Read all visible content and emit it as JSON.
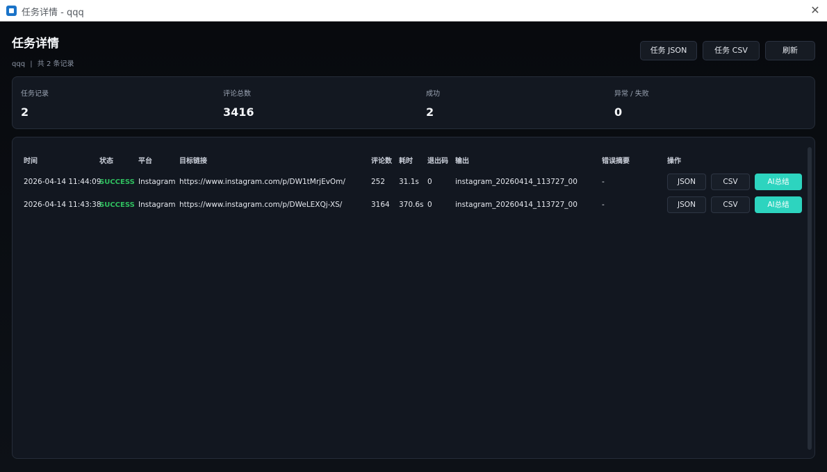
{
  "window": {
    "title": "任务详情 - qqq",
    "close_glyph": "✕"
  },
  "header": {
    "title": "任务详情",
    "task_name": "qqq",
    "separator": "|",
    "record_count": "共 2 条记录",
    "buttons": {
      "task_json": "任务 JSON",
      "task_csv": "任务 CSV",
      "refresh": "刷新"
    }
  },
  "stats": {
    "records": {
      "label": "任务记录",
      "value": "2"
    },
    "comments": {
      "label": "评论总数",
      "value": "3416"
    },
    "success": {
      "label": "成功",
      "value": "2"
    },
    "failed": {
      "label": "异常 / 失败",
      "value": "0"
    }
  },
  "table": {
    "columns": {
      "time": "时间",
      "status": "状态",
      "platform": "平台",
      "target": "目标链接",
      "comments": "评论数",
      "duration": "耗时",
      "exit_code": "退出码",
      "output": "输出",
      "error": "错误摘要",
      "actions": "操作"
    },
    "rows": [
      {
        "time": "2026-04-14 11:44:09",
        "status": "SUCCESS",
        "platform": "Instagram",
        "target": "https://www.instagram.com/p/DW1tMrjEvOm/",
        "comments": "252",
        "duration": "31.1s",
        "exit_code": "0",
        "output": "instagram_20260414_113727_00",
        "error": "-",
        "actions": {
          "json": "JSON",
          "csv": "CSV",
          "ai": "AI总结"
        }
      },
      {
        "time": "2026-04-14 11:43:38",
        "status": "SUCCESS",
        "platform": "Instagram",
        "target": "https://www.instagram.com/p/DWeLEXQj-XS/",
        "comments": "3164",
        "duration": "370.6s",
        "exit_code": "0",
        "output": "instagram_20260414_113727_00",
        "error": "-",
        "actions": {
          "json": "JSON",
          "csv": "CSV",
          "ai": "AI总结"
        }
      }
    ]
  },
  "colors": {
    "background": "#0c0f14",
    "card": "#131821",
    "success": "#2fbf5f",
    "accent": "#2dd4bf",
    "app_icon": "#1a73c8"
  },
  "icons": {
    "app": "app-icon",
    "close": "close-icon"
  }
}
